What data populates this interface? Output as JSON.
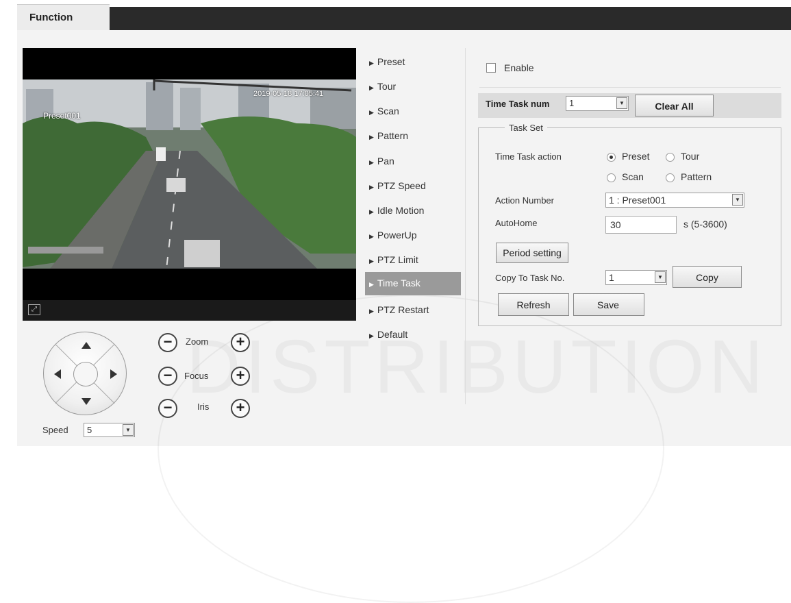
{
  "tab": {
    "label": "Function"
  },
  "video": {
    "osd_preset": "Preset001",
    "osd_time": "2019-05-18 17:05:41",
    "fullscreen_icon": "fullscreen-icon"
  },
  "ptz": {
    "zoom_label": "Zoom",
    "focus_label": "Focus",
    "iris_label": "Iris",
    "minus": "−",
    "plus": "+",
    "speed_label": "Speed",
    "speed_value": "5"
  },
  "menu": {
    "items": [
      {
        "label": "Preset"
      },
      {
        "label": "Tour"
      },
      {
        "label": "Scan"
      },
      {
        "label": "Pattern"
      },
      {
        "label": "Pan"
      },
      {
        "label": "PTZ Speed"
      },
      {
        "label": "Idle Motion"
      },
      {
        "label": "PowerUp"
      },
      {
        "label": "PTZ Limit"
      },
      {
        "label": "Time Task"
      },
      {
        "label": "PTZ Restart"
      },
      {
        "label": "Default"
      }
    ],
    "active": "Time Task"
  },
  "time_task": {
    "enable_label": "Enable",
    "num_label": "Time Task num",
    "num_value": "1",
    "clear_all": "Clear All",
    "task_set_legend": "Task Set",
    "action_label": "Time Task action",
    "actions": {
      "preset": "Preset",
      "tour": "Tour",
      "scan": "Scan",
      "pattern": "Pattern"
    },
    "selected_action": "Preset",
    "action_number_label": "Action Number",
    "action_number_value": "1 : Preset001",
    "autohome_label": "AutoHome",
    "autohome_value": "30",
    "autohome_unit": "s (5-3600)",
    "period_setting": "Period setting",
    "copy_to_label": "Copy To Task No.",
    "copy_to_value": "1",
    "copy_button": "Copy",
    "refresh_button": "Refresh",
    "save_button": "Save"
  },
  "watermark": "DISTRIBUTION"
}
